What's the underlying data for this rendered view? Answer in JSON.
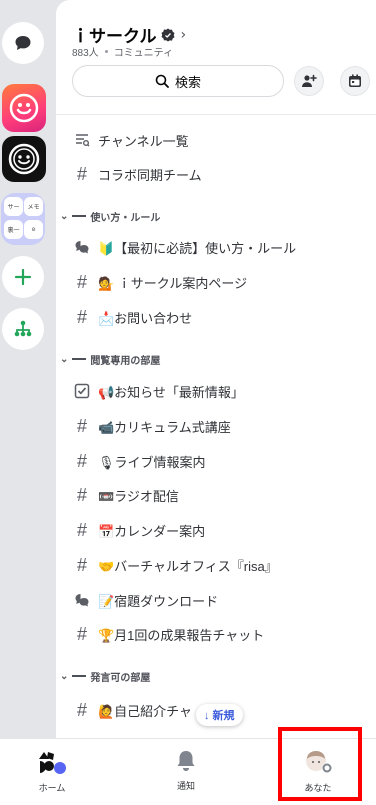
{
  "server": {
    "name": "ｉサークル",
    "members": "883人",
    "type": "コミュニティ"
  },
  "search": {
    "label": "検索"
  },
  "rail": {
    "folder_minis": [
      "サー",
      "メモ",
      "裏一",
      "⍝"
    ]
  },
  "top_channels": [
    {
      "icon": "channel-list-icon",
      "label": "チャンネル一覧"
    },
    {
      "icon": "hash-icon",
      "label": "コラボ同期チーム"
    }
  ],
  "categories": [
    {
      "name": "使い方・ルール",
      "channels": [
        {
          "icon": "forum-icon",
          "label": "🔰【最初に必読】使い方・ルール"
        },
        {
          "icon": "hash-icon",
          "label": "💁 ｉサークル案内ページ"
        },
        {
          "icon": "hash-icon",
          "label": "📩お問い合わせ"
        }
      ]
    },
    {
      "name": "閲覧専用の部屋",
      "channels": [
        {
          "icon": "announcement-icon",
          "label": "📢お知らせ「最新情報」"
        },
        {
          "icon": "hash-icon",
          "label": "📹カリキュラム式講座"
        },
        {
          "icon": "hash-icon",
          "label": "🎙ライブ情報案内"
        },
        {
          "icon": "hash-icon",
          "label": "📼ラジオ配信"
        },
        {
          "icon": "hash-icon",
          "label": "📅カレンダー案内"
        },
        {
          "icon": "hash-icon",
          "label": "🤝バーチャルオフィス『risa』"
        },
        {
          "icon": "forum-icon",
          "label": "📝宿題ダウンロード"
        },
        {
          "icon": "hash-icon",
          "label": "🏆月1回の成果報告チャット"
        }
      ]
    },
    {
      "name": "発言可の部屋",
      "channels": [
        {
          "icon": "hash-icon",
          "label": "🙋自己紹介チャ"
        }
      ]
    }
  ],
  "new_pill": {
    "label": "↓ 新規"
  },
  "tabs": {
    "home": "ホーム",
    "notifications": "通知",
    "you": "あなた"
  },
  "colors": {
    "accent": "#5865f2",
    "highlight": "#ff0000"
  }
}
